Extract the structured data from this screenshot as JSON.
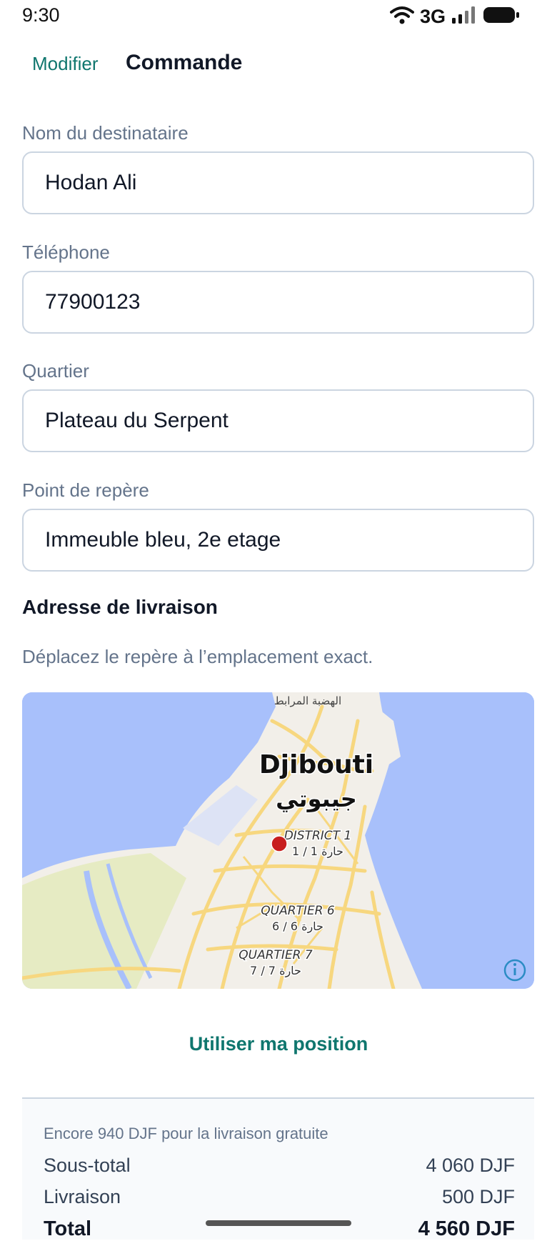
{
  "status_bar": {
    "time": "9:30",
    "network": "3G"
  },
  "header": {
    "back_label": "Modifier",
    "title": "Commande"
  },
  "form": {
    "name": {
      "label": "Nom du destinataire",
      "value": "Hodan Ali"
    },
    "phone": {
      "label": "Téléphone",
      "value": "77900123"
    },
    "district": {
      "label": "Quartier",
      "value": "Plateau du Serpent"
    },
    "landmark": {
      "label": "Point de repère",
      "value": "Immeuble bleu, 2e etage"
    }
  },
  "delivery": {
    "title": "Adresse de livraison",
    "hint": "Déplacez le repère à l’emplacement exact."
  },
  "map": {
    "city_name": "Djibouti",
    "city_name_ar": "جيبوتي",
    "top_label_ar": "الهضبة المرابط",
    "district1": "DISTRICT 1",
    "district1_ar": "حارة 1 / 1",
    "quartier6": "QUARTIER 6",
    "quartier6_ar": "حارة 6 / 6",
    "quartier7": "QUARTIER 7",
    "quartier7_ar": "حارة 7 / 7",
    "colors": {
      "water": "#a8c0fb",
      "land": "#f2efe9",
      "road": "#f7d77f",
      "pin": "#c81e1e",
      "park": "#e8ecc0"
    }
  },
  "actions": {
    "use_position": "Utiliser ma position"
  },
  "summary": {
    "free_delivery_note": "Encore 940 DJF pour la livraison gratuite",
    "subtotal_label": "Sous-total",
    "subtotal_value": "4 060 DJF",
    "delivery_label": "Livraison",
    "delivery_value": "500 DJF",
    "total_label": "Total",
    "total_value": "4 560 DJF"
  }
}
